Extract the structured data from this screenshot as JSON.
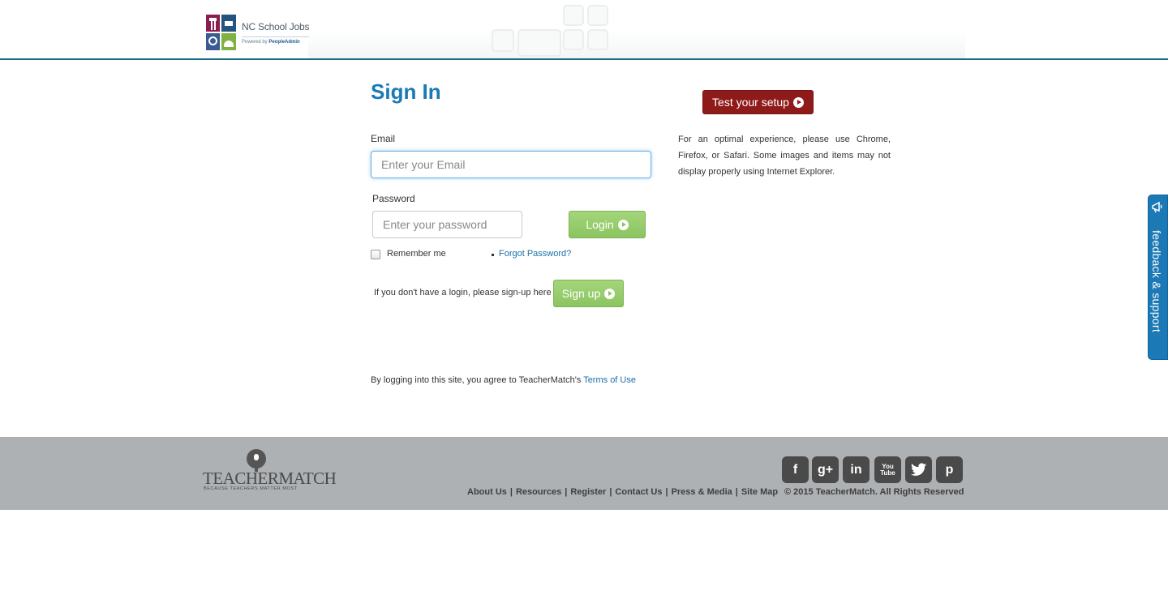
{
  "header": {
    "logo_title": "NC School Jobs",
    "logo_sub_prefix": "Powered by",
    "logo_sub_brand": "PeopleAdmin"
  },
  "signin": {
    "title": "Sign In",
    "email_label": "Email",
    "email_placeholder": "Enter your Email",
    "password_label": "Password",
    "password_placeholder": "Enter your password",
    "login_label": "Login",
    "remember_label": "Remember me",
    "forgot_label": "Forgot Password?",
    "signup_prompt": "If you don't have a login, please sign-up here",
    "signup_label": "Sign up",
    "terms_prefix": "By logging into this site, you agree to TeacherMatch's",
    "terms_link": "Terms of Use"
  },
  "setup": {
    "button_label": "Test your setup",
    "note": "For an optimal experience, please use Chrome, Firefox, or Safari. Some images and items may not display properly using Internet Explorer."
  },
  "feedback": {
    "label": "feedback & support",
    "icon": "megaphone-icon"
  },
  "footer": {
    "brand": "TEACHERMATCH",
    "tagline": "BECAUSE TEACHERS MATTER MOST",
    "social": [
      {
        "name": "facebook-icon",
        "glyph": "f"
      },
      {
        "name": "google-plus-icon",
        "glyph": "g+"
      },
      {
        "name": "linkedin-icon",
        "glyph": "in"
      },
      {
        "name": "youtube-icon",
        "glyph": "You Tube"
      },
      {
        "name": "twitter-icon",
        "glyph": "t"
      },
      {
        "name": "pinterest-icon",
        "glyph": "p"
      }
    ],
    "links": [
      "About Us",
      "Resources",
      "Register",
      "Contact Us",
      "Press & Media",
      "Site Map"
    ],
    "copyright": "© 2015 TeacherMatch. All Rights Reserved"
  },
  "colors": {
    "accent_blue": "#1a7ab5",
    "login_green": "#8cc460",
    "setup_red": "#8f1a1a",
    "footer_gray": "#aeb1b4"
  }
}
